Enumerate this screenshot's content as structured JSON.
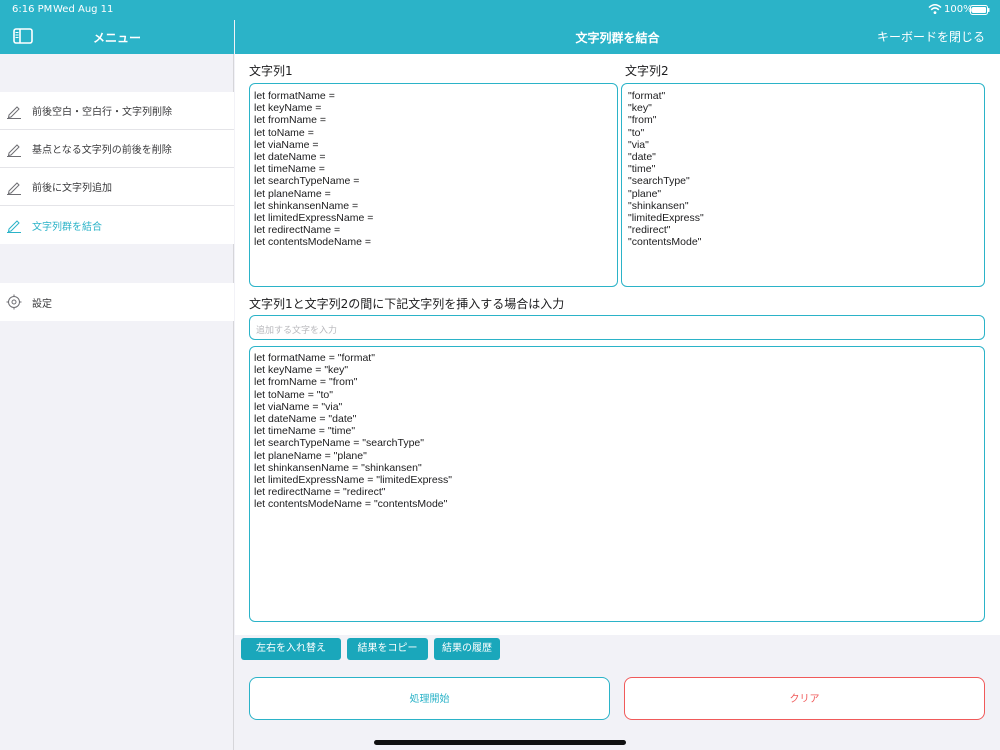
{
  "status_bar": {
    "time": "6:16 PM",
    "date": "Wed Aug 11",
    "battery": "100%"
  },
  "sidebar": {
    "title": "メニュー",
    "items": [
      {
        "label": "前後空白・空白行・文字列削除",
        "icon": "pencil-icon",
        "active": false
      },
      {
        "label": "基点となる文字列の前後を削除",
        "icon": "pencil-icon",
        "active": false
      },
      {
        "label": "前後に文字列追加",
        "icon": "pencil-icon",
        "active": false
      },
      {
        "label": "文字列群を結合",
        "icon": "pencil-icon",
        "active": true
      }
    ],
    "settings": {
      "label": "設定",
      "icon": "gear-icon"
    }
  },
  "main": {
    "title": "文字列群を結合",
    "close_keyboard": "キーボードを閉じる",
    "string1_label": "文字列1",
    "string2_label": "文字列2",
    "string1_lines": [
      "let formatName =",
      "let keyName =",
      "let fromName =",
      "let toName =",
      "let viaName =",
      "let dateName =",
      "let timeName =",
      "let searchTypeName =",
      "let planeName =",
      "let shinkansenName =",
      "let limitedExpressName =",
      "let redirectName =",
      "let contentsModeName ="
    ],
    "string2_lines": [
      "\"format\"",
      "\"key\"",
      "\"from\"",
      "\"to\"",
      "\"via\"",
      "\"date\"",
      "\"time\"",
      "\"searchType\"",
      "\"plane\"",
      "\"shinkansen\"",
      "\"limitedExpress\"",
      "\"redirect\"",
      "\"contentsMode\""
    ],
    "insert_label": "文字列1と文字列2の間に下記文字列を挿入する場合は入力",
    "insert_placeholder": "追加する文字を入力",
    "result_lines": [
      "let formatName = \"format\"",
      "let keyName = \"key\"",
      "let fromName = \"from\"",
      "let toName = \"to\"",
      "let viaName = \"via\"",
      "let dateName = \"date\"",
      "let timeName = \"time\"",
      "let searchTypeName = \"searchType\"",
      "let planeName = \"plane\"",
      "let shinkansenName = \"shinkansen\"",
      "let limitedExpressName = \"limitedExpress\"",
      "let redirectName = \"redirect\"",
      "let contentsModeName = \"contentsMode\""
    ],
    "buttons": {
      "swap": "左右を入れ替え",
      "copy": "結果をコピー",
      "history": "結果の履歴",
      "start": "処理開始",
      "clear": "クリア"
    }
  },
  "colors": {
    "accent": "#2bb3c8",
    "button": "#1aa7bb",
    "danger": "#f05a5a",
    "background": "#f2f2f7"
  }
}
